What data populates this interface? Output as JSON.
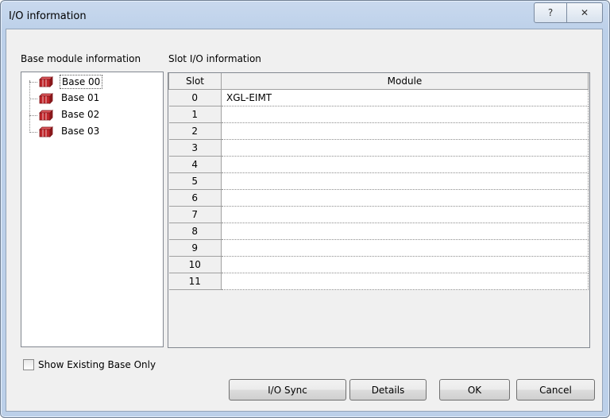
{
  "window": {
    "title": "I/O information",
    "help_glyph": "?",
    "close_glyph": "✕"
  },
  "labels": {
    "base_info": "Base module information",
    "slot_info": "Slot I/O information"
  },
  "tree": {
    "items": [
      {
        "label": "Base 00",
        "selected": true
      },
      {
        "label": "Base 01",
        "selected": false
      },
      {
        "label": "Base 02",
        "selected": false
      },
      {
        "label": "Base 03",
        "selected": false
      }
    ]
  },
  "table": {
    "headers": [
      "Slot",
      "Module"
    ],
    "rows": [
      {
        "slot": "0",
        "module": "XGL-EIMT"
      },
      {
        "slot": "1",
        "module": ""
      },
      {
        "slot": "2",
        "module": ""
      },
      {
        "slot": "3",
        "module": ""
      },
      {
        "slot": "4",
        "module": ""
      },
      {
        "slot": "5",
        "module": ""
      },
      {
        "slot": "6",
        "module": ""
      },
      {
        "slot": "7",
        "module": ""
      },
      {
        "slot": "8",
        "module": ""
      },
      {
        "slot": "9",
        "module": ""
      },
      {
        "slot": "10",
        "module": ""
      },
      {
        "slot": "11",
        "module": ""
      }
    ]
  },
  "options": {
    "show_existing_label": "Show Existing Base Only",
    "show_existing_checked": false
  },
  "buttons": {
    "io_sync": "I/O Sync",
    "details": "Details",
    "ok": "OK",
    "cancel": "Cancel"
  },
  "colors": {
    "title_bar": "#bcd0e9",
    "client": "#f0f0f0",
    "icon_red": "#c0262b"
  }
}
